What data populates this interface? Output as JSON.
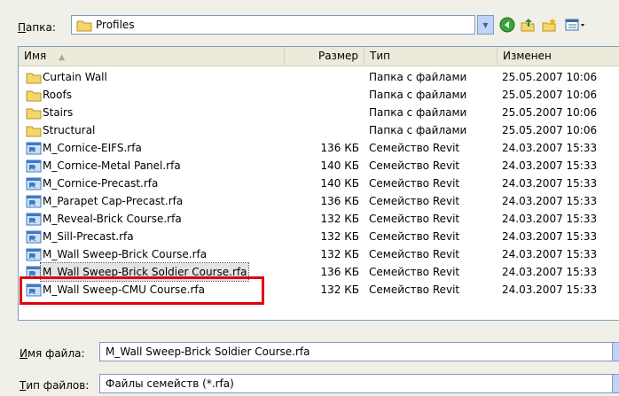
{
  "toolbar": {
    "folder_label": "Папка:",
    "folder_label_hotkey": "П",
    "folder_label_rest": "апка:",
    "folder_value": "Profiles",
    "dropdown_glyph": "▼",
    "back_glyph": "●",
    "up_glyph": "⬆",
    "newfolder_glyph": "✱",
    "views_glyph": "▦▾"
  },
  "columns": {
    "name": "Имя",
    "sort_glyph": "▲",
    "size": "Размер",
    "type": "Тип",
    "modified": "Изменен"
  },
  "rows": [
    {
      "name": "Curtain Wall",
      "size": "",
      "type": "Папка с файлами",
      "date": "25.05.2007 10:06",
      "icon": "folder-icon"
    },
    {
      "name": "Roofs",
      "size": "",
      "type": "Папка с файлами",
      "date": "25.05.2007 10:06",
      "icon": "folder-icon"
    },
    {
      "name": "Stairs",
      "size": "",
      "type": "Папка с файлами",
      "date": "25.05.2007 10:06",
      "icon": "folder-icon"
    },
    {
      "name": "Structural",
      "size": "",
      "type": "Папка с файлами",
      "date": "25.05.2007 10:06",
      "icon": "folder-icon"
    },
    {
      "name": "M_Cornice-EIFS.rfa",
      "size": "136 КБ",
      "type": "Семейство Revit",
      "date": "24.03.2007 15:33",
      "icon": "revit-family-icon"
    },
    {
      "name": "M_Cornice-Metal Panel.rfa",
      "size": "140 КБ",
      "type": "Семейство Revit",
      "date": "24.03.2007 15:33",
      "icon": "revit-family-icon"
    },
    {
      "name": "M_Cornice-Precast.rfa",
      "size": "140 КБ",
      "type": "Семейство Revit",
      "date": "24.03.2007 15:33",
      "icon": "revit-family-icon"
    },
    {
      "name": "M_Parapet Cap-Precast.rfa",
      "size": "136 КБ",
      "type": "Семейство Revit",
      "date": "24.03.2007 15:33",
      "icon": "revit-family-icon"
    },
    {
      "name": "M_Reveal-Brick Course.rfa",
      "size": "132 КБ",
      "type": "Семейство Revit",
      "date": "24.03.2007 15:33",
      "icon": "revit-family-icon"
    },
    {
      "name": "M_Sill-Precast.rfa",
      "size": "132 КБ",
      "type": "Семейство Revit",
      "date": "24.03.2007 15:33",
      "icon": "revit-family-icon"
    },
    {
      "name": "M_Wall Sweep-Brick Course.rfa",
      "size": "132 КБ",
      "type": "Семейство Revit",
      "date": "24.03.2007 15:33",
      "icon": "revit-family-icon"
    },
    {
      "name": "M_Wall Sweep-Brick Soldier Course.rfa",
      "size": "136 КБ",
      "type": "Семейство Revit",
      "date": "24.03.2007 15:33",
      "icon": "revit-family-icon",
      "selected": true
    },
    {
      "name": "M_Wall Sweep-CMU Course.rfa",
      "size": "132 КБ",
      "type": "Семейство Revit",
      "date": "24.03.2007 15:33",
      "icon": "revit-family-icon"
    }
  ],
  "filename": {
    "label": "Имя файла:",
    "label_hotkey": "И",
    "label_rest": "мя файла:",
    "value": "M_Wall Sweep-Brick Soldier Course.rfa"
  },
  "filetype": {
    "label": "Тип файлов:",
    "label_hotkey": "Т",
    "label_rest": "ип файлов:",
    "value": "Файлы семейств (*.rfa)"
  },
  "colors": {
    "highlight": "#e1000f",
    "folder": "#f5d66b",
    "revit": "#3d7bc4"
  }
}
